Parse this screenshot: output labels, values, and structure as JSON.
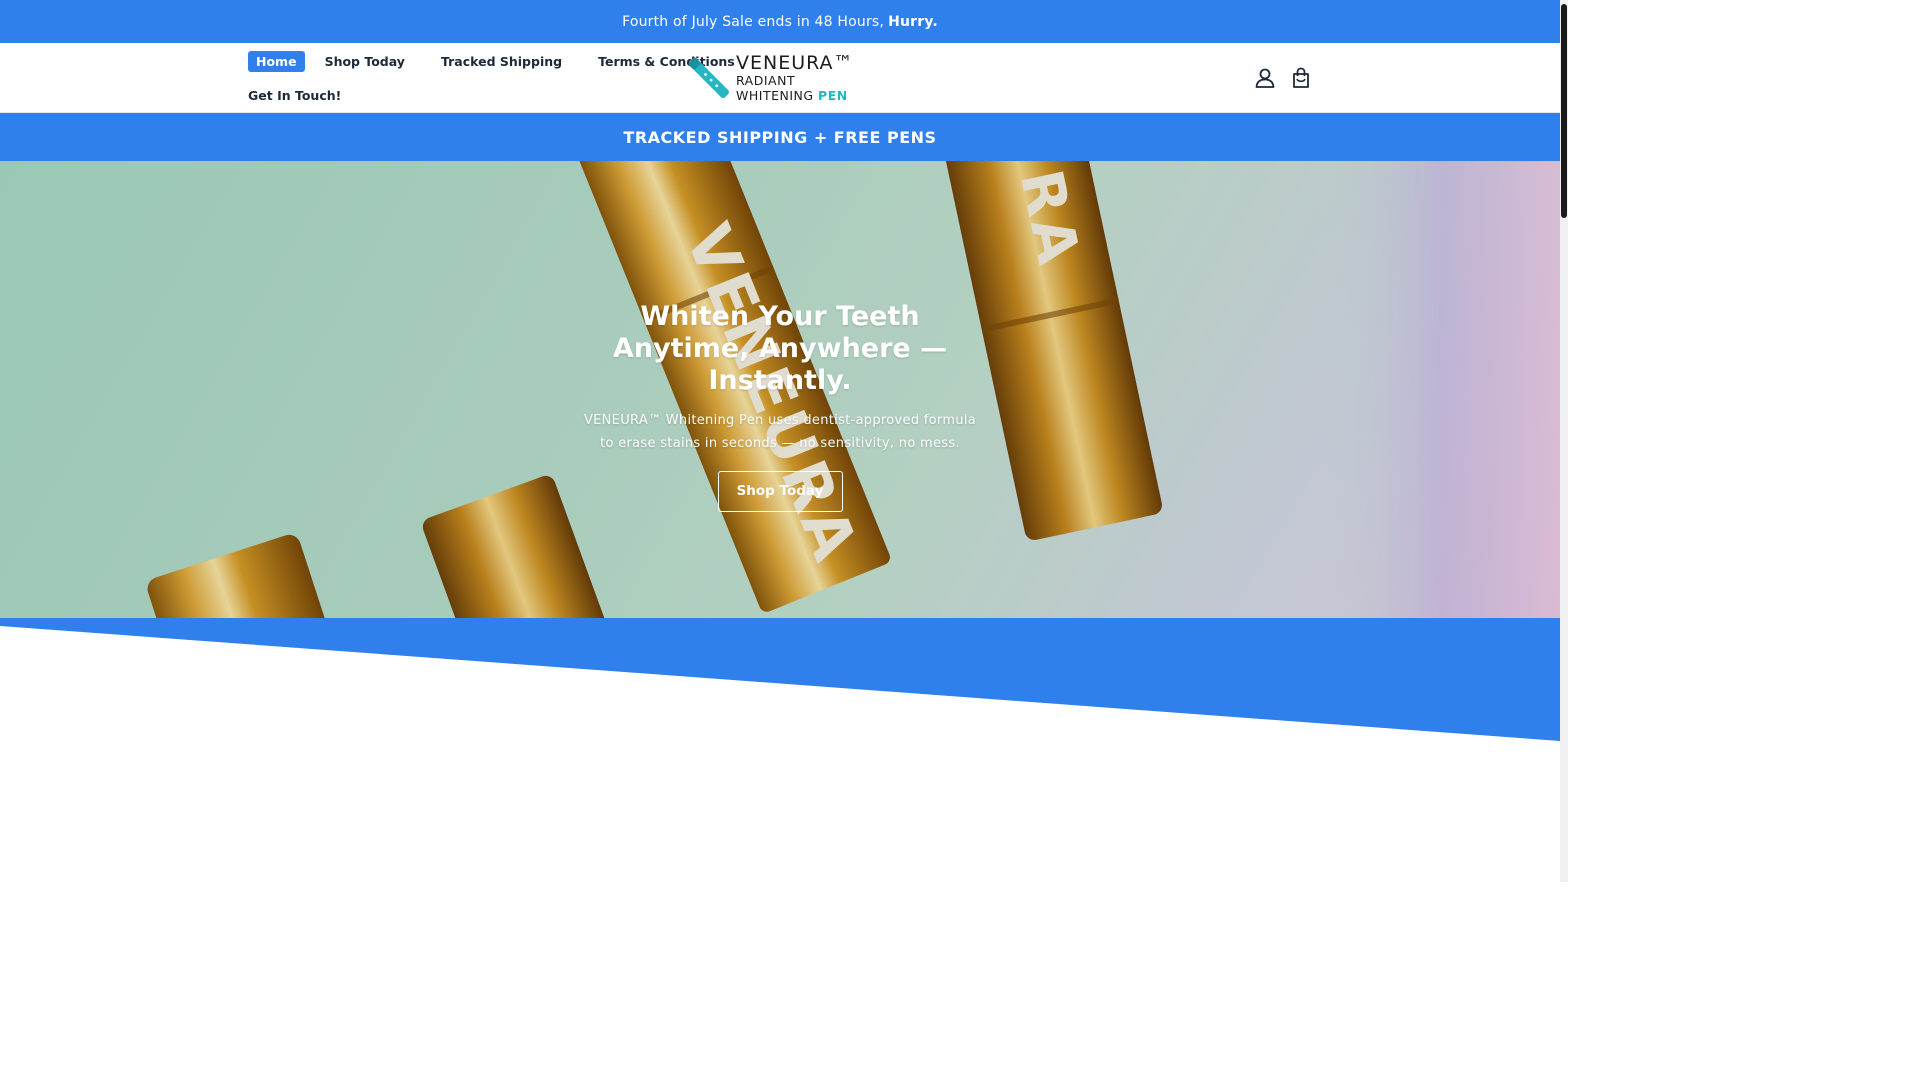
{
  "announcement": {
    "text": "Fourth of July Sale ends in 48 Hours,",
    "emphasis": "Hurry."
  },
  "nav": {
    "items": [
      {
        "label": "Home",
        "active": true
      },
      {
        "label": "Shop Today"
      },
      {
        "label": "Tracked Shipping"
      },
      {
        "label": "Terms & Conditions"
      },
      {
        "label": "Get In Touch!"
      }
    ]
  },
  "logo": {
    "line1": "VENEURA™",
    "line2": "RADIANT",
    "line3_a": "WHITENING",
    "line3_b": "PEN"
  },
  "header_icons": [
    "account-icon",
    "cart-icon"
  ],
  "shipping_bar": {
    "text": "TRACKED SHIPPING + FREE PENS"
  },
  "hero": {
    "title": "Whiten Your Teeth Anytime, Anywhere — Instantly.",
    "subtitle": "VENEURA™ Whitening Pen uses dentist-approved formula to erase stains in seconds — no sensitivity, no mess.",
    "button_label": "Shop Today"
  },
  "colors": {
    "accent": "#2f80ed",
    "logo_teal": "#25b6c4",
    "gold": "#d4a32a"
  }
}
